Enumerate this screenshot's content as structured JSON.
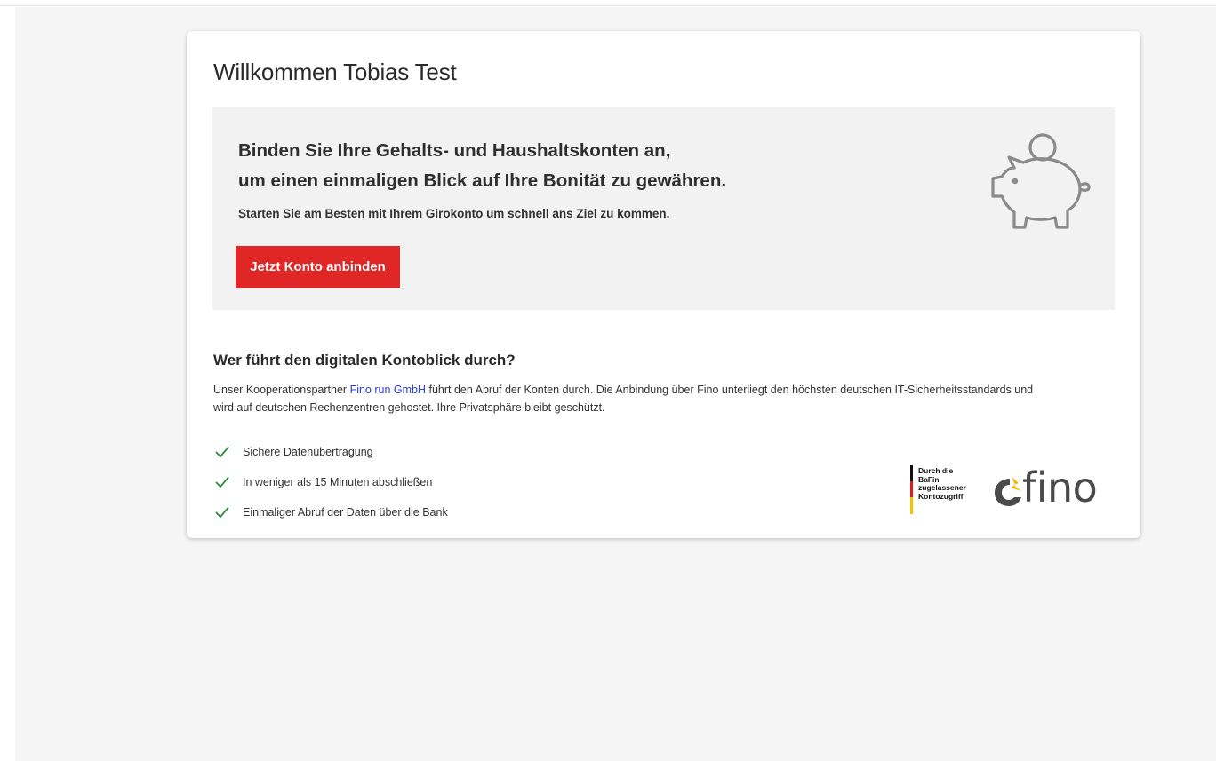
{
  "page": {
    "welcome": "Willkommen Tobias Test"
  },
  "banner": {
    "headline_line1": "Binden Sie Ihre Gehalts- und Haushaltskonten an,",
    "headline_line2": "um einen einmaligen Blick auf Ihre Bonität zu gewähren.",
    "subline": "Starten Sie am Besten mit Ihrem Girokonto um schnell ans Ziel zu kommen.",
    "cta_label": "Jetzt Konto anbinden",
    "icon": "piggy-bank-icon"
  },
  "info": {
    "title": "Wer führt den digitalen Kontoblick durch?",
    "desc_prefix": "Unser Kooperationspartner ",
    "partner_link": "Fino run GmbH",
    "desc_suffix": " führt den Abruf der Konten durch. Die Anbindung über Fino unterliegt den höchsten deutschen IT-Sicherheitsstandards und wird auf deutschen Rechenzentren gehostet. Ihre Privatsphäre bleibt geschützt.",
    "features": [
      "Sichere Datenübertragung",
      "In weniger als 15 Minuten abschließen",
      "Einmaliger Abruf der Daten über die Bank"
    ],
    "feature_icon": "checkmark-icon"
  },
  "logos": {
    "bafin_lines": [
      "Durch die",
      "BaFin",
      "zugelassener",
      "Kontozugriff"
    ],
    "fino_word": "fino"
  },
  "colors": {
    "accent_red": "#e12626",
    "link_blue": "#2a3fd6",
    "check_green": "#2e8b3e",
    "banner_bg": "#f2f2f2",
    "page_bg": "#f5f5f5"
  }
}
